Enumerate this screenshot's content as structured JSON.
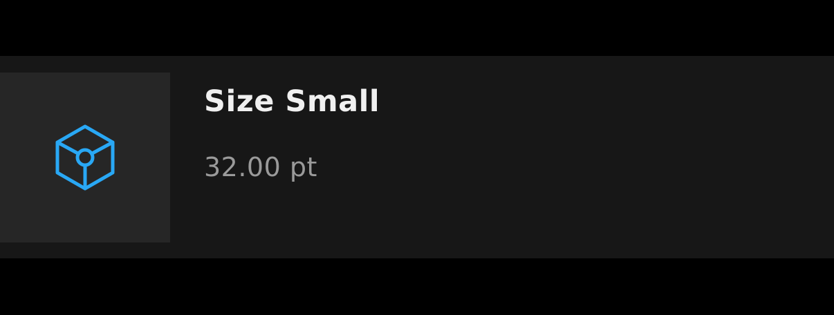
{
  "item": {
    "title": "Size Small",
    "value": "32.00 pt",
    "icon": "3d-cube-icon"
  },
  "colors": {
    "background": "#000000",
    "card": "#171717",
    "thumbnail": "#262626",
    "icon_accent": "#29a8f5",
    "title_text": "#f0f0f0",
    "value_text": "#9a9a9a"
  }
}
